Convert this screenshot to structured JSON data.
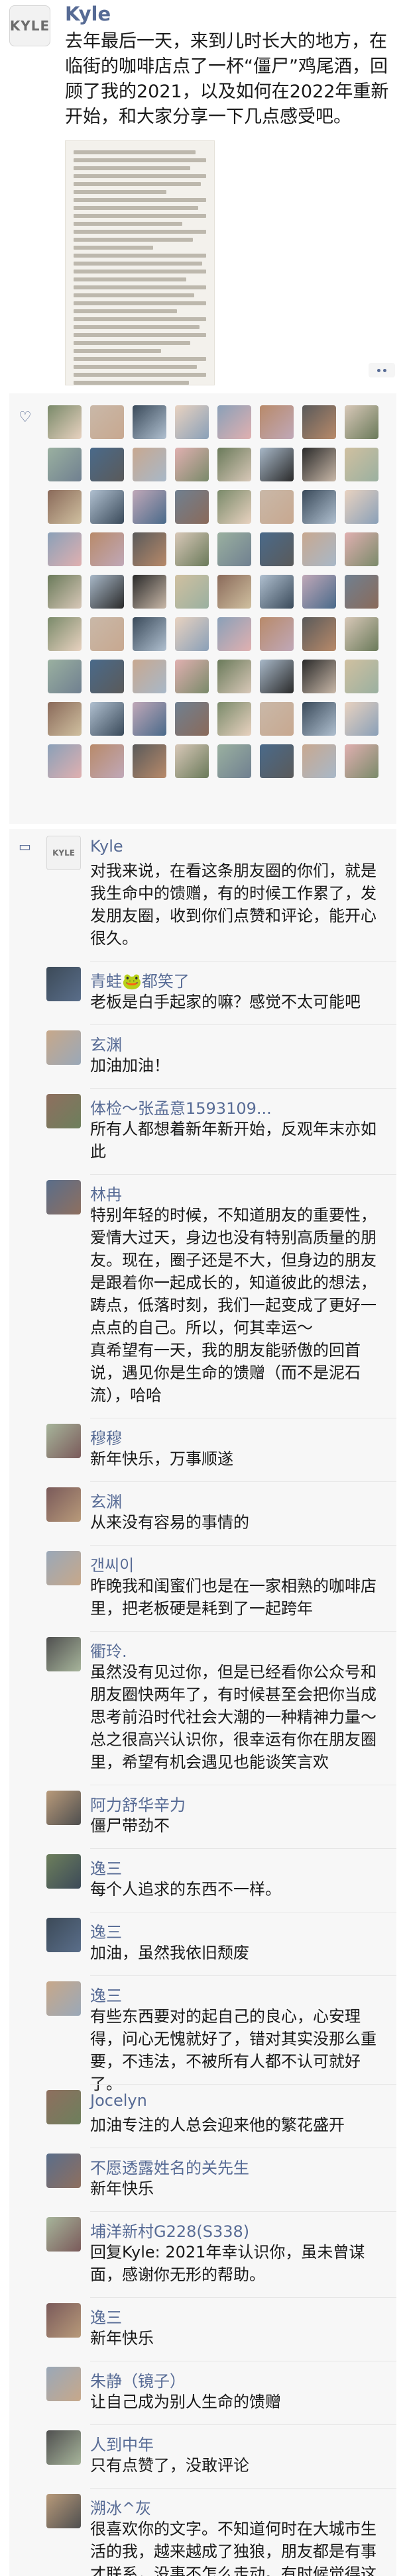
{
  "post": {
    "author": "Kyle",
    "avatar_text": "KYLE",
    "text": "去年最后一天，来到儿时长大的地方，在临街的咖啡店点了一杯“僵尸”鸡尾酒，回顾了我的2021，以及如何在2022年重新开始，和大家分享一下几点感受吧。"
  },
  "icons": {
    "likes": "heart-icon",
    "comments": "comment-icon",
    "more": "more-icon"
  },
  "likes": {
    "count": 72
  },
  "comments": [
    {
      "name": "Kyle",
      "text": "对我来说，在看这条朋友圈的你们，就是我生命中的馈赠，有的时候工作累了，发发朋友圈，收到你们点赞和评论，能开心很久。"
    },
    {
      "name": "青蛙🐸都笑了",
      "text": "老板是白手起家的嘛？感觉不太可能吧"
    },
    {
      "name": "玄渊",
      "text": "加油加油！"
    },
    {
      "name": "体检～张孟意1593109...",
      "text": "所有人都想着新年新开始，反观年末亦如此"
    },
    {
      "name": "林冉",
      "text": "特别年轻的时候，不知道朋友的重要性，爱情大过天，身边也没有特别高质量的朋友。现在，圈子还是不大，但身边的朋友是跟着你一起成长的，知道彼此的想法，踌点，低落时刻，我们一起变成了更好一点点的自己。所以，何其幸运～\n真希望有一天，我的朋友能骄傲的回首说，遇见你是生命的馈赠（而不是泥石流），哈哈"
    },
    {
      "name": "穆穆",
      "text": "新年快乐，万事顺遂"
    },
    {
      "name": "玄渊",
      "text": "从来没有容易的事情的"
    },
    {
      "name": "갠씨이",
      "text": "昨晚我和闺蜜们也是在一家相熟的咖啡店里，把老板硬是耗到了一起跨年"
    },
    {
      "name": "衢玲.",
      "text": "虽然没有见过你，但是已经看你公众号和朋友圈快两年了，有时候甚至会把你当成思考前沿时代社会大潮的一种精神力量～总之很高兴认识你，很幸运有你在朋友圈里，希望有机会遇见也能谈笑言欢"
    },
    {
      "name": "阿力舒华辛力",
      "text": "僵尸带劲不"
    },
    {
      "name": "逸三",
      "text": "每个人追求的东西不一样。"
    },
    {
      "name": "逸三",
      "text": "加油，虽然我依旧颓废"
    },
    {
      "name": "逸三",
      "text": "有些东西要对的起自己的良心，心安理得，问心无愧就好了，错对其实没那么重要，不违法，不被所有人都不认可就好了。"
    },
    {
      "name": "Jocelyn",
      "text": "加油专注的人总会迎来他的繁花盛开"
    },
    {
      "name": "不愿透露姓名的关先生",
      "text": "新年快乐"
    },
    {
      "name": "埔洋新村G228(S338)",
      "text": "回复Kyle: 2021年幸认识你，虽未曾谋面，感谢你无形的帮助。"
    },
    {
      "name": "逸三",
      "text": "新年快乐"
    },
    {
      "name": "朱静（镜子）",
      "text": "让自己成为别人生命的馈赠"
    },
    {
      "name": "人到中年",
      "text": "只有点赞了，没敢评论"
    },
    {
      "name": "溯冰^灰",
      "text": "很喜欢你的文字。不知道何时在大城市生活的我，越来越成了独狼，朋友都是有事才联系，没事不怎么走动。有时候觉得这种关系也挺牢靠稳定的，但是总觉得有时候一个人抗下困难有些孤独。应该怎样去打破这种状态呢？感觉一个人独惯了..."
    }
  ]
}
